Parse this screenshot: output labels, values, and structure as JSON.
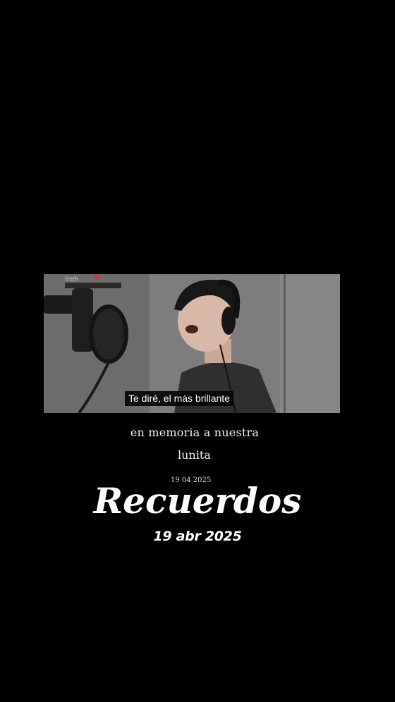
{
  "video": {
    "watermark": "Ireh",
    "heart_icon": "heart-icon",
    "subtitle": "Te diré, el más brillante"
  },
  "caption": {
    "line1": "en memoria a nuestra",
    "line2": "lunita",
    "small_date": "19 04 2025"
  },
  "title": "Recuerdos",
  "date": "19 abr 2025"
}
